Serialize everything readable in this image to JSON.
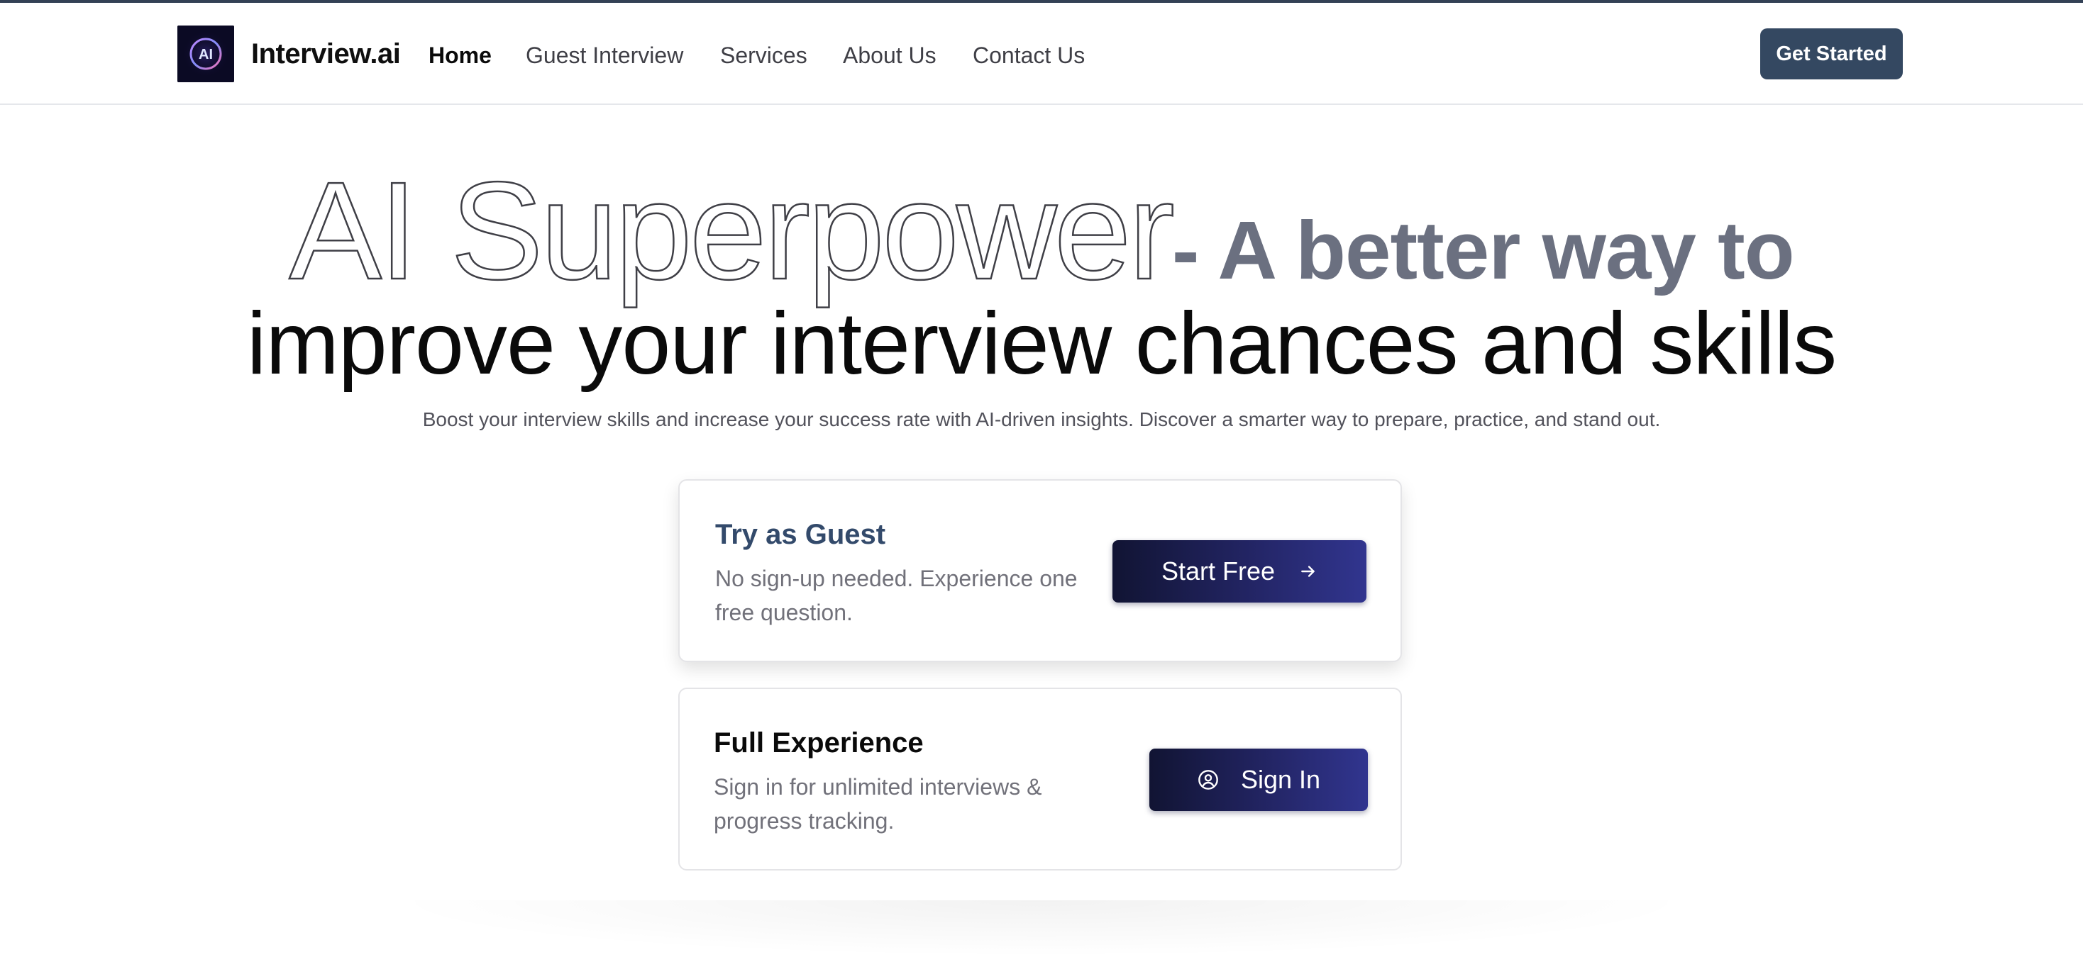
{
  "brand": {
    "logo_text": "AI",
    "name": "Interview.ai"
  },
  "nav": {
    "items": [
      {
        "label": "Home",
        "active": true
      },
      {
        "label": "Guest Interview",
        "active": false
      },
      {
        "label": "Services",
        "active": false
      },
      {
        "label": "About Us",
        "active": false
      },
      {
        "label": "Contact Us",
        "active": false
      }
    ],
    "cta_label": "Get Started"
  },
  "hero": {
    "headline_outline": "AI Superpower",
    "headline_accent": "- A better way to",
    "headline_line2": "improve your interview chances and skills",
    "subtitle": "Boost your interview skills and increase your success rate with AI-driven insights. Discover a smarter way to prepare, practice, and stand out."
  },
  "cards": {
    "guest": {
      "title": "Try as Guest",
      "description": "No sign-up needed. Experience one free question.",
      "button_label": "Start Free",
      "button_icon": "arrow-right-icon"
    },
    "full": {
      "title": "Full Experience",
      "description": "Sign in for unlimited interviews & progress tracking.",
      "button_label": "Sign In",
      "button_icon": "user-circle-icon"
    }
  },
  "colors": {
    "primary_button": "#344861",
    "cta_gradient_start": "#111433",
    "cta_gradient_end": "#31358f",
    "accent_gray": "#6b7080",
    "guest_title": "#334a6b"
  }
}
